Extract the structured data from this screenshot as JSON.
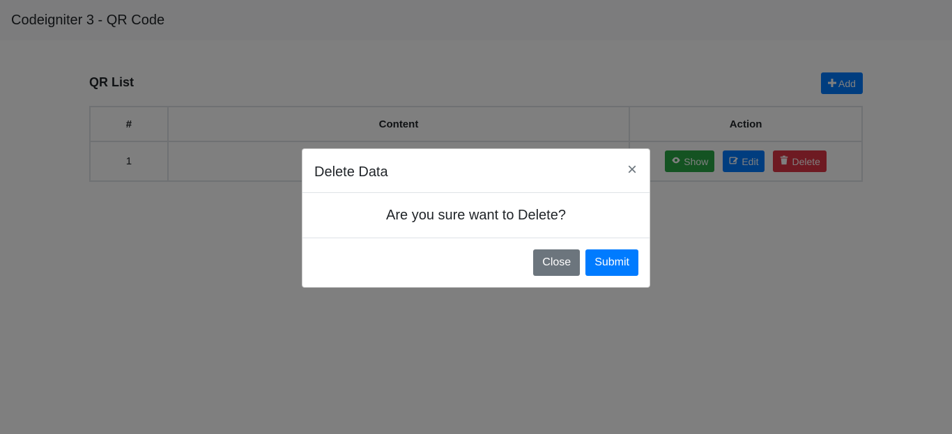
{
  "navbar": {
    "brand": "Codeigniter 3 - QR Code"
  },
  "list": {
    "title": "QR List",
    "add_label": "Add",
    "columns": [
      "#",
      "Content",
      "Action"
    ],
    "rows": [
      {
        "num": "1",
        "content": "",
        "show_label": "Show",
        "edit_label": "Edit",
        "delete_label": "Delete"
      }
    ]
  },
  "modal": {
    "title": "Delete Data",
    "close_glyph": "×",
    "message": "Are you sure want to Delete?",
    "close_label": "Close",
    "submit_label": "Submit"
  },
  "colors": {
    "primary": "#007bff",
    "success": "#28a745",
    "danger": "#dc3545",
    "secondary": "#6c757d",
    "backdrop": "rgba(0,0,0,0.5)"
  },
  "icons": {
    "add": "plus-icon",
    "show": "eye-icon",
    "edit": "edit-icon",
    "delete": "trash-icon",
    "modal_close": "close-icon"
  }
}
